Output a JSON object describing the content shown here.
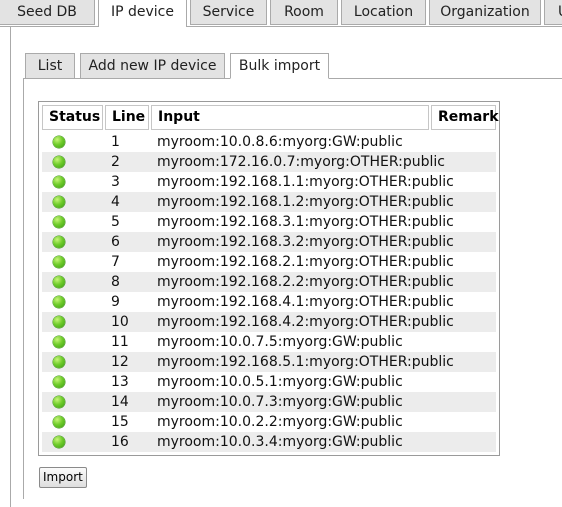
{
  "top_tabs": [
    {
      "label": "Seed DB"
    },
    {
      "label": "IP device"
    },
    {
      "label": "Service"
    },
    {
      "label": "Room"
    },
    {
      "label": "Location"
    },
    {
      "label": "Organization"
    },
    {
      "label": "U"
    }
  ],
  "active_top_tab": "IP device",
  "sub_tabs": [
    {
      "label": "List"
    },
    {
      "label": "Add new IP device"
    },
    {
      "label": "Bulk import"
    }
  ],
  "active_sub_tab": "Bulk import",
  "table": {
    "headers": {
      "status": "Status",
      "line": "Line",
      "input": "Input",
      "remark": "Remark"
    },
    "status_color": "#5cc21f",
    "rows": [
      {
        "line": "1",
        "input": "myroom:10.0.8.6:myorg:GW:public",
        "remark": ""
      },
      {
        "line": "2",
        "input": "myroom:172.16.0.7:myorg:OTHER:public",
        "remark": ""
      },
      {
        "line": "3",
        "input": "myroom:192.168.1.1:myorg:OTHER:public",
        "remark": ""
      },
      {
        "line": "4",
        "input": "myroom:192.168.1.2:myorg:OTHER:public",
        "remark": ""
      },
      {
        "line": "5",
        "input": "myroom:192.168.3.1:myorg:OTHER:public",
        "remark": ""
      },
      {
        "line": "6",
        "input": "myroom:192.168.3.2:myorg:OTHER:public",
        "remark": ""
      },
      {
        "line": "7",
        "input": "myroom:192.168.2.1:myorg:OTHER:public",
        "remark": ""
      },
      {
        "line": "8",
        "input": "myroom:192.168.2.2:myorg:OTHER:public",
        "remark": ""
      },
      {
        "line": "9",
        "input": "myroom:192.168.4.1:myorg:OTHER:public",
        "remark": ""
      },
      {
        "line": "10",
        "input": "myroom:192.168.4.2:myorg:OTHER:public",
        "remark": ""
      },
      {
        "line": "11",
        "input": "myroom:10.0.7.5:myorg:GW:public",
        "remark": ""
      },
      {
        "line": "12",
        "input": "myroom:192.168.5.1:myorg:OTHER:public",
        "remark": ""
      },
      {
        "line": "13",
        "input": "myroom:10.0.5.1:myorg:GW:public",
        "remark": ""
      },
      {
        "line": "14",
        "input": "myroom:10.0.7.3:myorg:GW:public",
        "remark": ""
      },
      {
        "line": "15",
        "input": "myroom:10.0.2.2:myorg:GW:public",
        "remark": ""
      },
      {
        "line": "16",
        "input": "myroom:10.0.3.4:myorg:GW:public",
        "remark": ""
      }
    ]
  },
  "import_button": {
    "label": "Import"
  }
}
